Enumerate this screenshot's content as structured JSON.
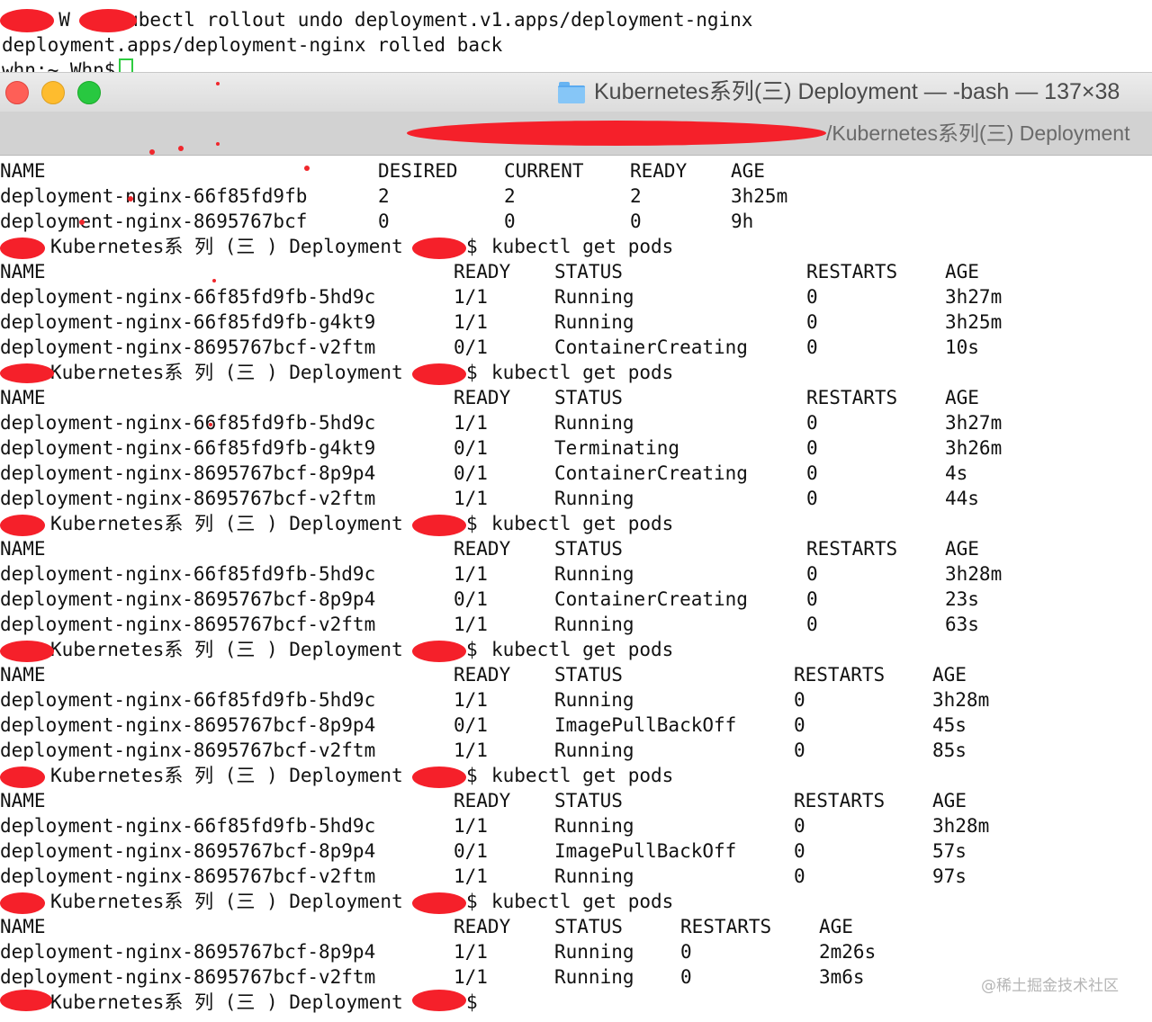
{
  "background_terminal": {
    "lines": [
      "   ~ W    kubectl rollout undo deployment.v1.apps/deployment-nginx",
      "deployment.apps/deployment-nginx rolled back",
      "whn:~ Whn$"
    ]
  },
  "window": {
    "title": "Kubernetes系列(三) Deployment — -bash — 137×38",
    "tab_title": "/Kubernetes系列(三) Deployment",
    "folder_icon": "folder-icon",
    "traffic_lights": {
      "close": "#fe5f57",
      "minimize": "#febc2e",
      "zoom": "#28c840"
    }
  },
  "terminal": {
    "replicaset_header": [
      "NAME",
      "DESIRED",
      "CURRENT",
      "READY",
      "AGE"
    ],
    "replicasets": [
      [
        "deployment-nginx-66f85fd9fb",
        "2",
        "2",
        "2",
        "3h25m"
      ],
      [
        "deployment-nginx-8695767bcf",
        "0",
        "0",
        "0",
        "9h"
      ]
    ],
    "prompt_dir": "Kubernetes系 列 (三 ) Deployment",
    "prompt_suffix": "$",
    "command": "kubectl get pods",
    "blocks": [
      {
        "header": [
          "NAME",
          "READY",
          "STATUS",
          "RESTARTS",
          "AGE"
        ],
        "rows": [
          [
            "deployment-nginx-66f85fd9fb-5hd9c",
            "1/1",
            "Running",
            "0",
            "3h27m"
          ],
          [
            "deployment-nginx-66f85fd9fb-g4kt9",
            "1/1",
            "Running",
            "0",
            "3h25m"
          ],
          [
            "deployment-nginx-8695767bcf-v2ftm",
            "0/1",
            "ContainerCreating",
            "0",
            "10s"
          ]
        ]
      },
      {
        "header": [
          "NAME",
          "READY",
          "STATUS",
          "RESTARTS",
          "AGE"
        ],
        "rows": [
          [
            "deployment-nginx-66f85fd9fb-5hd9c",
            "1/1",
            "Running",
            "0",
            "3h27m"
          ],
          [
            "deployment-nginx-66f85fd9fb-g4kt9",
            "0/1",
            "Terminating",
            "0",
            "3h26m"
          ],
          [
            "deployment-nginx-8695767bcf-8p9p4",
            "0/1",
            "ContainerCreating",
            "0",
            "4s"
          ],
          [
            "deployment-nginx-8695767bcf-v2ftm",
            "1/1",
            "Running",
            "0",
            "44s"
          ]
        ]
      },
      {
        "header": [
          "NAME",
          "READY",
          "STATUS",
          "RESTARTS",
          "AGE"
        ],
        "rows": [
          [
            "deployment-nginx-66f85fd9fb-5hd9c",
            "1/1",
            "Running",
            "0",
            "3h28m"
          ],
          [
            "deployment-nginx-8695767bcf-8p9p4",
            "0/1",
            "ContainerCreating",
            "0",
            "23s"
          ],
          [
            "deployment-nginx-8695767bcf-v2ftm",
            "1/1",
            "Running",
            "0",
            "63s"
          ]
        ]
      },
      {
        "header": [
          "NAME",
          "READY",
          "STATUS",
          "RESTARTS",
          "AGE"
        ],
        "rows": [
          [
            "deployment-nginx-66f85fd9fb-5hd9c",
            "1/1",
            "Running",
            "0",
            "3h28m"
          ],
          [
            "deployment-nginx-8695767bcf-8p9p4",
            "0/1",
            "ImagePullBackOff",
            "0",
            "45s"
          ],
          [
            "deployment-nginx-8695767bcf-v2ftm",
            "1/1",
            "Running",
            "0",
            "85s"
          ]
        ]
      },
      {
        "header": [
          "NAME",
          "READY",
          "STATUS",
          "RESTARTS",
          "AGE"
        ],
        "rows": [
          [
            "deployment-nginx-66f85fd9fb-5hd9c",
            "1/1",
            "Running",
            "0",
            "3h28m"
          ],
          [
            "deployment-nginx-8695767bcf-8p9p4",
            "0/1",
            "ImagePullBackOff",
            "0",
            "57s"
          ],
          [
            "deployment-nginx-8695767bcf-v2ftm",
            "1/1",
            "Running",
            "0",
            "97s"
          ]
        ]
      },
      {
        "header": [
          "NAME",
          "READY",
          "STATUS",
          "RESTARTS",
          "AGE"
        ],
        "rows": [
          [
            "deployment-nginx-8695767bcf-8p9p4",
            "1/1",
            "Running",
            "0",
            "2m26s"
          ],
          [
            "deployment-nginx-8695767bcf-v2ftm",
            "1/1",
            "Running",
            "0",
            "3m6s"
          ]
        ]
      }
    ]
  },
  "watermark": "@稀土掘金技术社区",
  "colors": {
    "redaction": "#f5202a",
    "cursor": "#2ecc40"
  }
}
